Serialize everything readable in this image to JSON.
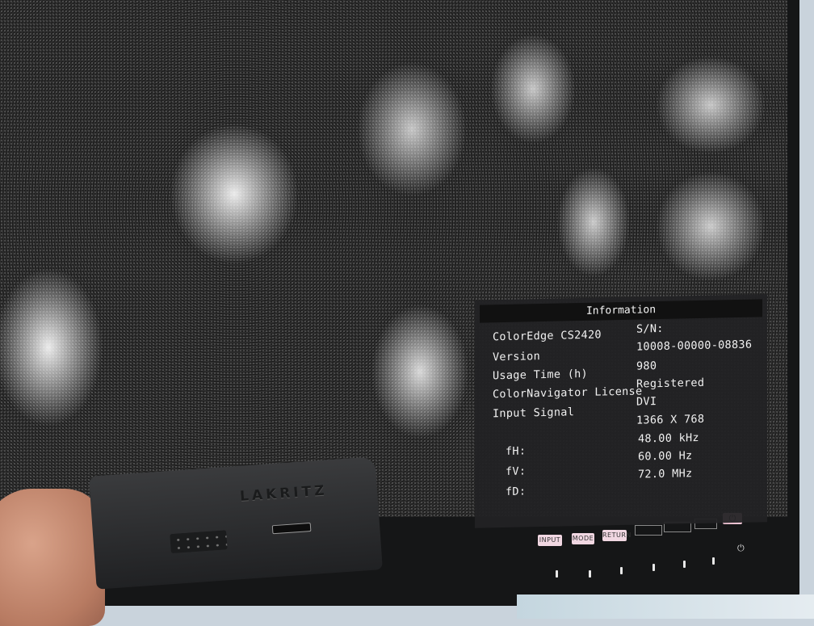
{
  "osd": {
    "title": "Information",
    "model": "ColorEdge CS2420",
    "serial_label": "S/N:",
    "serial_value": "10008-00000-08836",
    "version_label": "Version",
    "usage_label": "Usage Time (h)",
    "usage_value": "980",
    "license_label": "ColorNavigator License",
    "license_value": "Registered",
    "input_label": "Input Signal",
    "input_value": "DVI",
    "resolution": "1366 X 768",
    "fh_value": "48.00 kHz",
    "fh_label": "fH:",
    "fv_value": "60.00 Hz",
    "fv_label": "fV:",
    "fd_value": "72.0  MHz",
    "fd_label": "fD:"
  },
  "buttons": {
    "input": "INPUT",
    "mode": "MODE",
    "return": "RETURN",
    "power_symbol": "⏻",
    "power_led": "⏻"
  },
  "device": {
    "brand": "LAKRITZ"
  }
}
